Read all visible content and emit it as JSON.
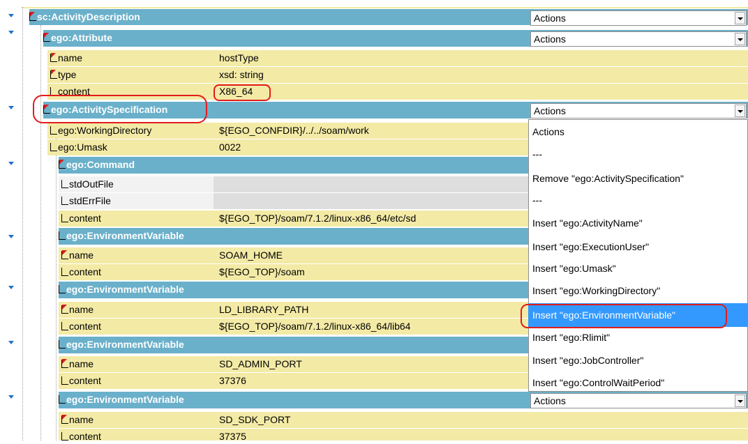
{
  "tree": {
    "activity": {
      "label": "sc:ActivityDescription",
      "actions": "Actions"
    },
    "attribute": {
      "label": "ego:Attribute",
      "actions": "Actions",
      "fields": [
        {
          "name": "name",
          "value": "hostType"
        },
        {
          "name": "type",
          "value": "xsd: string"
        },
        {
          "name": "content",
          "value": "X86_64"
        }
      ]
    },
    "spec": {
      "label": "ego:ActivitySpecification",
      "actions": "Actions",
      "fields": [
        {
          "name": "ego:WorkingDirectory",
          "value": "${EGO_CONFDIR}/../../soam/work"
        },
        {
          "name": "ego:Umask",
          "value": "0022"
        }
      ]
    },
    "command": {
      "label": "ego:Command",
      "fields": [
        {
          "name": "stdOutFile",
          "value": ""
        },
        {
          "name": "stdErrFile",
          "value": ""
        },
        {
          "name": "content",
          "value": "${EGO_TOP}/soam/7.1.2/linux-x86_64/etc/sd"
        }
      ]
    },
    "env": [
      {
        "label": "ego:EnvironmentVariable",
        "fields": [
          {
            "name": "name",
            "value": "SOAM_HOME"
          },
          {
            "name": "content",
            "value": "${EGO_TOP}/soam"
          }
        ]
      },
      {
        "label": "ego:EnvironmentVariable",
        "fields": [
          {
            "name": "name",
            "value": "LD_LIBRARY_PATH"
          },
          {
            "name": "content",
            "value": "${EGO_TOP}/soam/7.1.2/linux-x86_64/lib64"
          }
        ]
      },
      {
        "label": "ego:EnvironmentVariable",
        "fields": [
          {
            "name": "name",
            "value": "SD_ADMIN_PORT"
          },
          {
            "name": "content",
            "value": "37376"
          }
        ]
      },
      {
        "label": "ego:EnvironmentVariable",
        "actions": "Actions",
        "fields": [
          {
            "name": "name",
            "value": "SD_SDK_PORT"
          },
          {
            "name": "content",
            "value": "37375"
          }
        ]
      }
    ]
  },
  "menu": {
    "items": [
      "Actions",
      "---",
      "Remove \"ego:ActivitySpecification\"",
      "---",
      "Insert \"ego:ActivityName\"",
      "Insert \"ego:ExecutionUser\"",
      "Insert \"ego:Umask\"",
      "Insert \"ego:WorkingDirectory\"",
      "Insert \"ego:EnvironmentVariable\"",
      "Insert \"ego:Rlimit\"",
      "Insert \"ego:JobController\"",
      "Insert \"ego:ControlWaitPeriod\""
    ],
    "highlighted_index": 8
  },
  "colors": {
    "header_blue": "#6ab0ca",
    "row_yellow": "#f3eaa6",
    "highlight_blue": "#3399ff",
    "annotation_red": "#e21c1c"
  }
}
